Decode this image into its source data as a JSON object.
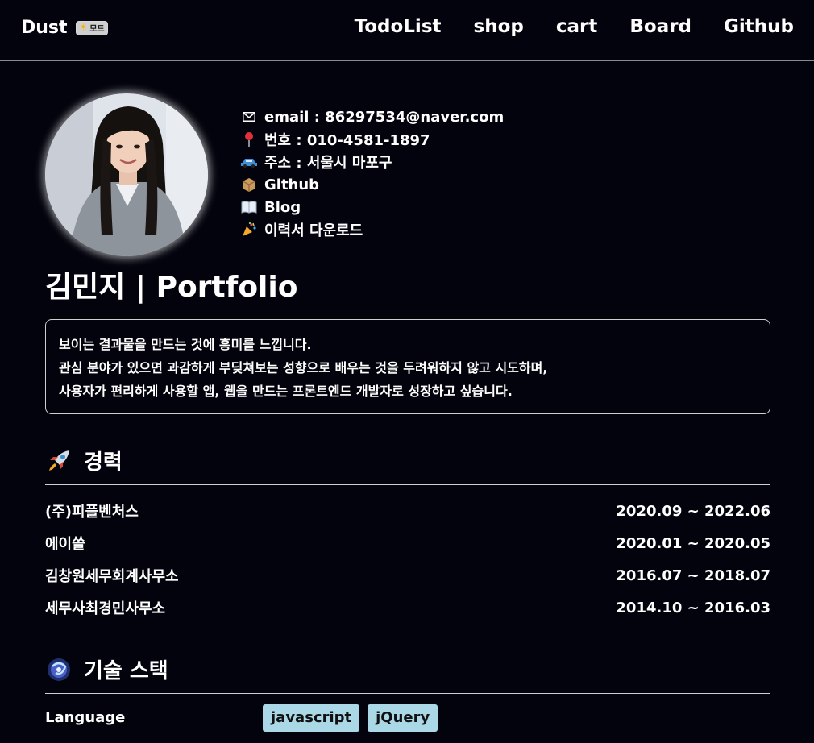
{
  "nav": {
    "brand": "Dust",
    "mode_label": "모드",
    "links": [
      "TodoList",
      "shop",
      "cart",
      "Board",
      "Github"
    ]
  },
  "profile": {
    "email": "email : 86297534@naver.com",
    "phone": "번호 : 010-4581-1897",
    "address": "주소 : 서울시 마포구",
    "github": "Github",
    "blog": "Blog",
    "resume": "이력서 다운로드"
  },
  "title": "김민지 | Portfolio",
  "intro": [
    "보이는 결과물을 만드는 것에 흥미를 느낍니다.",
    "관심 분야가 있으면 과감하게 부딪쳐보는 성향으로 배우는 것을 두려워하지 않고 시도하며,",
    "사용자가 편리하게 사용할 앱, 웹을 만드는 프론트엔드 개발자로 성장하고 싶습니다."
  ],
  "career": {
    "heading": "경력",
    "items": [
      {
        "company": "(주)피플벤처스",
        "period": "2020.09 ~ 2022.06"
      },
      {
        "company": "에이쏠",
        "period": "2020.01 ~ 2020.05"
      },
      {
        "company": "김창원세무회계사무소",
        "period": "2016.07 ~ 2018.07"
      },
      {
        "company": "세무사최경민사무소",
        "period": "2014.10 ~ 2016.03"
      }
    ]
  },
  "stack": {
    "heading": "기술 스택",
    "rows": [
      {
        "label": "Language",
        "tags": [
          "javascript",
          "jQuery"
        ]
      }
    ]
  },
  "colors": {
    "background": "#03030d",
    "tag_bg": "#aad8e6"
  },
  "icons": {
    "email": "envelope-icon",
    "phone": "pin-icon",
    "address": "car-icon",
    "github": "box-icon",
    "blog": "book-icon",
    "resume": "party-popper-icon",
    "career": "rocket-icon",
    "stack": "galaxy-icon"
  }
}
